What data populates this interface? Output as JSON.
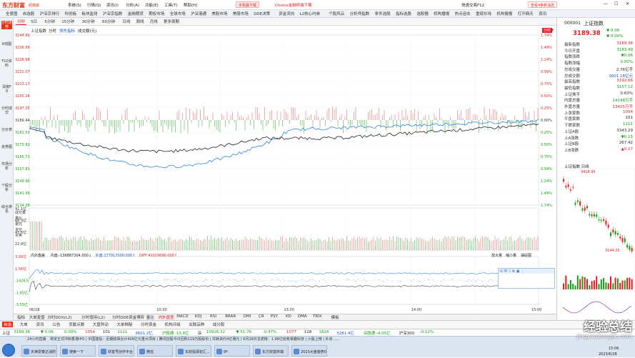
{
  "app": {
    "logo": "东方财富",
    "logo_sub": "经典版",
    "phone_download": "手机版下载",
    "choice_download": "Choice金融终端下载",
    "quick_trade": "快速交易F12",
    "view_msg": "查看4条新消息",
    "minimize": "—",
    "maximize": "☐",
    "close": "✕"
  },
  "menus_top": [
    "系统(S)",
    "行情(Q)",
    "资讯(I)",
    "分析(A)",
    "功能(E)",
    "工具(T)",
    "帮助(H)"
  ],
  "menubar": [
    "全景图",
    "自选股",
    "沪深京排行",
    "科创板",
    "板块监测",
    "沪深京指数",
    "金融期货",
    "期权市场",
    "全球市场",
    "沪深港通",
    "美股市场",
    "美股市场",
    "DDE决策",
    "资金流向",
    "L2核心内参",
    "个股风云",
    "分析师指数",
    "条件选股",
    "指标选股",
    "选股器",
    "机构播报",
    "热点追击",
    "重磅长线",
    "机构撤报",
    "打开鼎天",
    "资讯"
  ],
  "leftnav": [
    "分时走势",
    "K线图",
    "F10资料",
    "深度F9",
    "分时成交",
    "分价表",
    "走势图",
    "市场分析",
    "个股分析",
    "综合排名"
  ],
  "periods": [
    "分时",
    "5日",
    "5分钟",
    "15分钟",
    "30分钟",
    "60分钟",
    "日线",
    "周线",
    "月线",
    "更多周期"
  ],
  "chart": {
    "index_name": "上证指数",
    "tab_fenshi": "分时",
    "tab_leading": "领先指标",
    "tab_vol": "成交额(元)",
    "ylabels_left": [
      "3244.80",
      "3236.89",
      "3228.98",
      "3221.07",
      "3213.17",
      "3205.26",
      "3197.35",
      "3189.44",
      "3181.53",
      "3173.62",
      "3165.71",
      "3157.81",
      "3149.90",
      "3141.99",
      "3134.08"
    ],
    "ylabels_right": [
      "1.74%",
      "1.49%",
      "1.24%",
      "0.99%",
      "0.75%",
      "0.50%",
      "0.25%",
      "0.00%",
      "0.25%",
      "0.50%",
      "0.75%",
      "0.99%",
      "1.24%",
      "1.49%",
      "1.74%"
    ],
    "vol_labels": [
      "91.1亿",
      "68.3亿",
      "45.6亿",
      "22.8亿"
    ],
    "xlabels": [
      "06/28",
      "10:30",
      "13:30",
      "14:00",
      "15:00"
    ],
    "ind_labels": [
      "3.26亿",
      "1.56亿",
      "-1426万",
      "-1.85亿",
      "-3.55亿"
    ],
    "ind_legend_name": "内外盘差",
    "ind_legend_inner": "内盘:-136887304.000↓",
    "ind_legend_outer": "外盘:177917000.000↑",
    "ind_legend_diff": "DIFF:41029696.000↑",
    "vol_buttons": [
      "放大量",
      "缩小量",
      "抽屉图"
    ],
    "side_buttons": [
      "成交量",
      "量比",
      "委托",
      "多空",
      "买卖"
    ],
    "fenshi_btn": "分时",
    "plus_btn": "+"
  },
  "indicator_tabs": [
    "指标",
    "大单复盘",
    "分时DDX(L2)",
    "分时增持(L2)",
    "分时DDE资金博弈",
    "量比",
    "内外盘差",
    "MACD",
    "KDJ",
    "RSI",
    "BRAR",
    "DMI",
    "CR",
    "PSY",
    "KD",
    "DMA",
    "TRIX",
    "模板"
  ],
  "right": {
    "code": "000001",
    "name": "上证指数",
    "price": "3189.38",
    "change": "▼ 0.06",
    "change_pct": "▼ 0.00%",
    "rows": [
      {
        "k": "最新指数",
        "v": "3189.38",
        "c": "red"
      },
      {
        "k": "今日开盘",
        "v": "3183.49",
        "c": "grn"
      },
      {
        "k": "指数涨跌",
        "v": "▼0.06",
        "c": "grn"
      },
      {
        "k": "指数涨幅",
        "v": "0.00%",
        "c": "grn"
      },
      {
        "k": "总成交量",
        "v": "2.76亿手",
        "c": ""
      },
      {
        "k": "总成交额",
        "v": "3601.18亿元",
        "c": "blu"
      },
      {
        "k": "最高指数",
        "v": "3192.66",
        "c": "red"
      },
      {
        "k": "最低指数",
        "v": "3157.12",
        "c": "grn"
      },
      {
        "k": "上证换手",
        "v": "0.63%",
        "c": ""
      },
      {
        "k": "内盘总量",
        "v": "14198万手",
        "c": "grn"
      },
      {
        "k": "外盘总量",
        "v": "13425万手",
        "c": "red"
      },
      {
        "k": "上涨家数",
        "v": "1054",
        "c": "red"
      },
      {
        "k": "平盘家数",
        "v": "101",
        "c": ""
      },
      {
        "k": "下跌家数",
        "v": "1111",
        "c": "grn"
      },
      {
        "k": "上证A股",
        "v": "3343.29",
        "c": ""
      },
      {
        "k": "上A涨跌",
        "v": "▼0.15",
        "c": "grn"
      },
      {
        "k": "上证B股",
        "v": "267.42",
        "c": ""
      },
      {
        "k": "上B涨跌",
        "v": "▲0.17",
        "c": "red"
      }
    ],
    "mini_title": "上证指数 日线",
    "mini_high": "3418.95",
    "mini_low": "3144.25"
  },
  "stockbar": [
    "自选",
    "大单",
    "资讯",
    "公告",
    "贡献点数",
    "大盘异动",
    "大单揭秘",
    "分时资金",
    "机构评级",
    "关联品种",
    "成分股"
  ],
  "ticker": [
    {
      "t": "上证",
      "c": ""
    },
    {
      "t": "3189.38",
      "c": "grn"
    },
    {
      "t": "▼ 0.06",
      "c": "grn"
    },
    {
      "t": "0.00%",
      "c": "grn"
    },
    {
      "t": "1054",
      "c": "red"
    },
    {
      "t": "101",
      "c": ""
    },
    {
      "t": "1111",
      "c": "grn"
    },
    {
      "t": "3601.2亿",
      "c": "blu"
    },
    {
      "t": "沪股通 -13.8亿",
      "c": "grn"
    },
    {
      "t": "深",
      "c": ""
    },
    {
      "t": "10926.32",
      "c": "grn"
    },
    {
      "t": "▼ 51.76",
      "c": "grn"
    },
    {
      "t": "-0.47%",
      "c": "grn"
    },
    {
      "t": "1077",
      "c": "red"
    },
    {
      "t": "118",
      "c": ""
    },
    {
      "t": "1628",
      "c": "grn"
    },
    {
      "t": "5281.4亿",
      "c": "blu"
    },
    {
      "t": "深股通 -4.05亿",
      "c": "grn"
    },
    {
      "t": "沪深300",
      "c": ""
    },
    {
      "t": "-0.12%",
      "c": "grn"
    }
  ],
  "news": {
    "label": "24小时直播",
    "text": "埃安正式冲刺香港IPO | 中国建投：近期获得合计409亿元重大项目 | 腾讯控股今日回购119万股股份 | 共耗资约4亿港元 | 6月28日龙虎榜：1.98亿抢筹掌趣科技 | 六股上榜 | 外资……"
  },
  "taskbar": [
    {
      "t": "天津爱泰达消防论坛"
    },
    {
      "t": "搜索一下"
    },
    {
      "t": "财富号创作平台"
    },
    {
      "t": "微信"
    },
    {
      "t": "东财投顾初汇..."
    },
    {
      "t": "gs"
    },
    {
      "t": "东方财富终端"
    },
    {
      "t": "2023大盘趋势05..."
    }
  ],
  "tray": {
    "time": "15:06",
    "date": "2023/6/28"
  },
  "watermark": {
    "main": "经验总结",
    "sub": "jingyanzongjie.com"
  }
}
